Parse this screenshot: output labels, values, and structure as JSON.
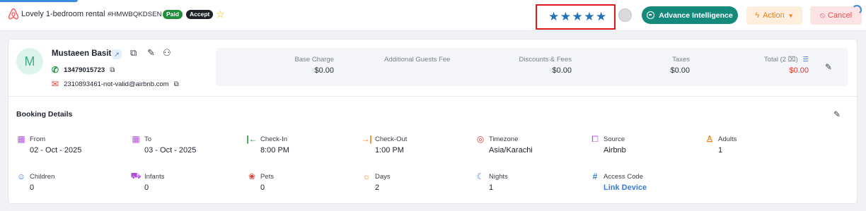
{
  "header": {
    "listing_title": "Lovely 1-bedroom rental",
    "booking_code": "#HMWBQKDSEN",
    "badge_paid": "Paid",
    "badge_accept": "Accept",
    "rating_stars": "★★★★★",
    "rating_value": 5,
    "advance_intelligence_label": "Advance Intelligence",
    "action_label": "Action",
    "cancel_label": "Cancel"
  },
  "guest": {
    "initial": "M",
    "name": "Mustaeen Basit",
    "phone": "13479015723",
    "email": "2310893461-not-valid@airbnb.com"
  },
  "financials": {
    "base_charge_label": "Base Charge",
    "base_charge_value": "$0.00",
    "additional_guests_label": "Additional Guests Fee",
    "discounts_label": "Discounts & Fees",
    "discounts_value": "$0.00",
    "taxes_label": "Taxes",
    "taxes_value": "$0.00",
    "total_label": "Total (2 ⌧)",
    "total_value": "$0.00"
  },
  "booking": {
    "title": "Booking Details",
    "from_label": "From",
    "from_value": "02 - Oct - 2025",
    "to_label": "To",
    "to_value": "03 - Oct - 2025",
    "checkin_label": "Check-In",
    "checkin_value": "8:00 PM",
    "checkout_label": "Check-Out",
    "checkout_value": "1:00 PM",
    "timezone_label": "Timezone",
    "timezone_value": "Asia/Karachi",
    "source_label": "Source",
    "source_value": "Airbnb",
    "adults_label": "Adults",
    "adults_value": "1",
    "children_label": "Children",
    "children_value": "0",
    "infants_label": "Infants",
    "infants_value": "0",
    "pets_label": "Pets",
    "pets_value": "0",
    "days_label": "Days",
    "days_value": "2",
    "nights_label": "Nights",
    "nights_value": "1",
    "access_code_label": "Access Code",
    "access_code_value": "Link Device"
  },
  "colors": {
    "brand_airbnb": "#ff5a5f",
    "accent_teal": "#138a7c",
    "star_blue": "#1f72b8",
    "highlight_red": "#e0181d",
    "total_red": "#e0392f"
  },
  "icons": {
    "brand": "airbnb-logo-icon",
    "favorite": "star-outline-icon",
    "ai": "ai-chip-icon",
    "action": "lightning-icon",
    "cancel": "ban-icon"
  }
}
